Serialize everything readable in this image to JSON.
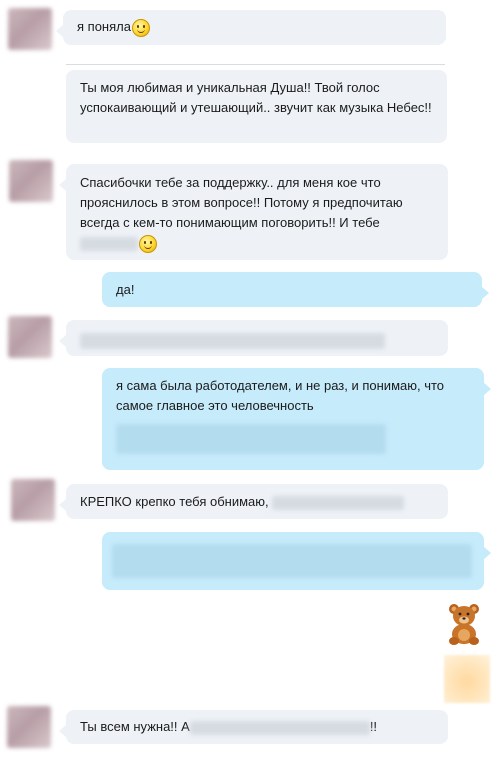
{
  "messages": [
    {
      "side": "in",
      "text": "я поняла"
    },
    {
      "side": "in",
      "text": "Ты моя любимая и уникальная Душа!! Твой голос успокаивающий и утешающий.. звучит как музыка Небес!!"
    },
    {
      "side": "in",
      "text_line1": "Спасибочки тебе за поддержку.. для меня кое что",
      "text_line2": "прояснилось в этом вопросе!! Потому я предпочитаю",
      "text_line3": "всегда с кем-то понимающим поговорить!! И тебе"
    },
    {
      "side": "out",
      "text": "да!"
    },
    {
      "side": "in",
      "text": ""
    },
    {
      "side": "out",
      "text": "я сама была работодателем, и не раз, и понимаю, что самое главное это человечность"
    },
    {
      "side": "in",
      "text": "КРЕПКО крепко тебя обнимаю,"
    },
    {
      "side": "out",
      "text": ""
    },
    {
      "side": "in",
      "text_before": "Ты всем нужна!! А",
      "text_after": "!!"
    }
  ],
  "icons": {
    "smile": "smiley-emoji-icon",
    "bear": "teddy-bear-sticker-icon"
  },
  "colors": {
    "incoming_bubble": "#eef2f7",
    "outgoing_bubble": "#c6ebfb",
    "background": "#ffffff"
  }
}
